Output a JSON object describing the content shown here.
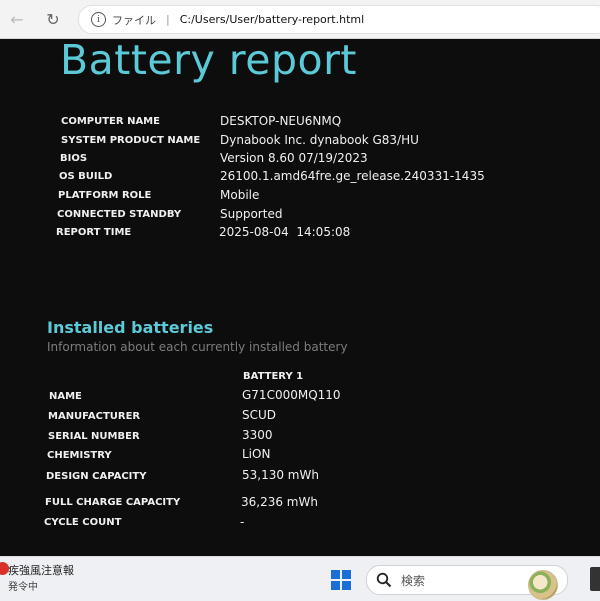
{
  "browser": {
    "file_label": "ファイル",
    "separator": "|",
    "url": "C:/Users/User/battery-report.html"
  },
  "report": {
    "title": "Battery report",
    "system_info": [
      {
        "label": "COMPUTER NAME",
        "value": "DESKTOP-NEU6NMQ"
      },
      {
        "label": "SYSTEM PRODUCT NAME",
        "value": "Dynabook Inc. dynabook G83/HU"
      },
      {
        "label": "BIOS",
        "value": "Version 8.60 07/19/2023"
      },
      {
        "label": "OS BUILD",
        "value": "26100.1.amd64fre.ge_release.240331-1435"
      },
      {
        "label": "PLATFORM ROLE",
        "value": "Mobile"
      },
      {
        "label": "CONNECTED STANDBY",
        "value": "Supported"
      },
      {
        "label": "REPORT TIME",
        "value": "2025-08-04  14:05:08"
      }
    ],
    "installed": {
      "title": "Installed batteries",
      "subtitle": "Information about each currently installed battery",
      "column_header": "BATTERY 1",
      "rows": [
        {
          "label": "NAME",
          "value": "G71C000MQ110"
        },
        {
          "label": "MANUFACTURER",
          "value": "SCUD"
        },
        {
          "label": "SERIAL NUMBER",
          "value": "3300"
        },
        {
          "label": "CHEMISTRY",
          "value": "LiON"
        },
        {
          "label": "DESIGN CAPACITY",
          "value": "53,130 mWh"
        },
        {
          "label": "FULL CHARGE CAPACITY",
          "value": "36,236 mWh"
        },
        {
          "label": "CYCLE COUNT",
          "value": "-"
        }
      ]
    }
  },
  "taskbar": {
    "weather_title": "疾強風注意報",
    "weather_sub": "発令中",
    "search_placeholder": "検索"
  },
  "colors": {
    "accent": "#5cc9d6",
    "background": "#0d0d0d",
    "alert": "#d9302a"
  }
}
